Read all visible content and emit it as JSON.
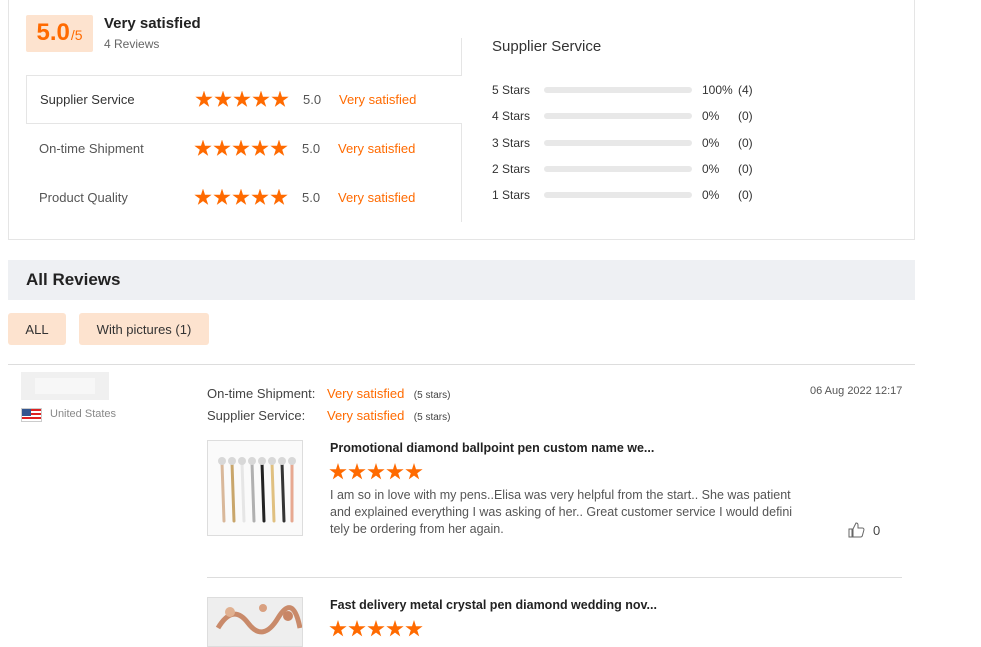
{
  "summary": {
    "score": "5.0",
    "score_max": "/5",
    "overall_label": "Very satisfied",
    "review_count": "4 Reviews",
    "ratings": [
      {
        "name": "Supplier Service",
        "value": "5.0",
        "text": "Very satisfied",
        "stars": 5
      },
      {
        "name": "On-time Shipment",
        "value": "5.0",
        "text": "Very satisfied",
        "stars": 5
      },
      {
        "name": "Product Quality",
        "value": "5.0",
        "text": "Very satisfied",
        "stars": 5
      }
    ],
    "distribution_title": "Supplier Service",
    "distribution": [
      {
        "label": "5  Stars",
        "fraction": 1.0,
        "pct": "100%",
        "count": "(4)"
      },
      {
        "label": "4  Stars",
        "fraction": 0,
        "pct": "0%",
        "count": "(0)"
      },
      {
        "label": "3  Stars",
        "fraction": 0,
        "pct": "0%",
        "count": "(0)"
      },
      {
        "label": "2  Stars",
        "fraction": 0,
        "pct": "0%",
        "count": "(0)"
      },
      {
        "label": "1  Stars",
        "fraction": 0,
        "pct": "0%",
        "count": "(0)"
      }
    ]
  },
  "reviews_section": {
    "title": "All Reviews",
    "filters": [
      "ALL",
      "With pictures (1)"
    ]
  },
  "review": {
    "country": "United States",
    "date": "06 Aug 2022 12:17",
    "shipment_label": "On-time Shipment:",
    "shipment_value": "Very satisfied",
    "shipment_stars": "(5 stars)",
    "service_label": "Supplier Service:",
    "service_value": "Very satisfied",
    "service_stars": "(5 stars)",
    "products": [
      {
        "title": "Promotional diamond ballpoint pen custom name we...",
        "stars": 5,
        "text": "I am so in love with my pens..Elisa was very helpful from the start.. She was patient and explained everything I was asking of her.. Great customer service I would definitely be ordering from her again.",
        "likes": "0"
      },
      {
        "title": "Fast delivery metal crystal pen diamond wedding nov...",
        "stars": 5
      }
    ]
  },
  "colors": {
    "accent": "#ff6a00",
    "badge_bg": "#fde3cf"
  },
  "icons": [
    "star-icon",
    "us-flag-icon",
    "thumbs-up-icon"
  ]
}
